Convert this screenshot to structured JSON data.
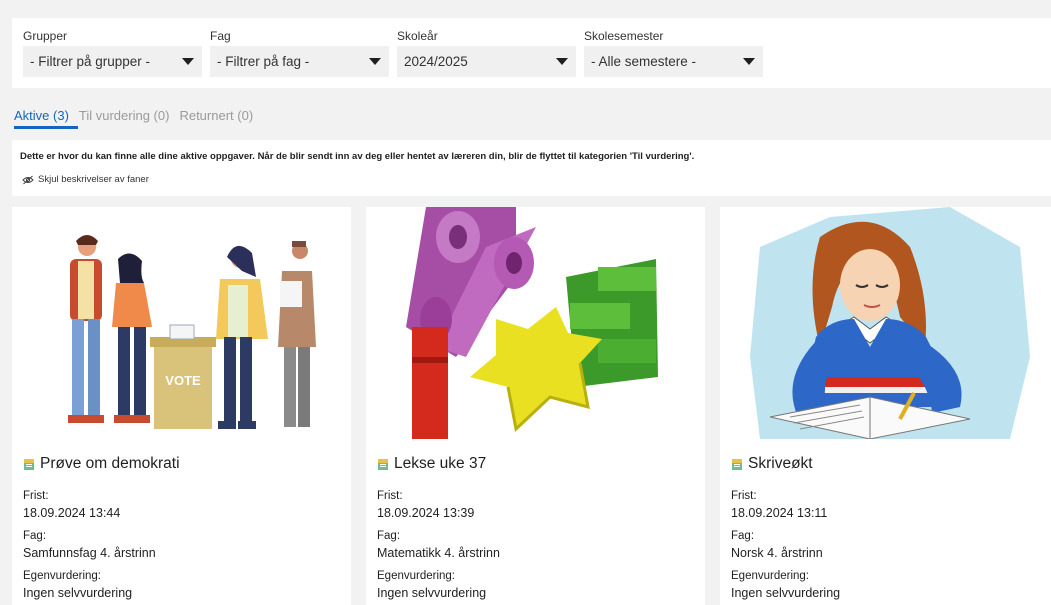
{
  "filters": [
    {
      "label": "Grupper",
      "value": "- Filtrer på grupper -"
    },
    {
      "label": "Fag",
      "value": "- Filtrer på fag -"
    },
    {
      "label": "Skoleår",
      "value": "2024/2025"
    },
    {
      "label": "Skolesemester",
      "value": "- Alle semestere -"
    }
  ],
  "tabs": [
    {
      "label": "Aktive (3)",
      "active": true
    },
    {
      "label": "Til vurdering (0)",
      "active": false
    },
    {
      "label": "Returnert (0)",
      "active": false
    }
  ],
  "description": "Dette er hvor du kan finne alle dine aktive oppgaver. Når de blir sendt inn av deg eller hentet av læreren din, blir de flyttet til kategorien 'Til vurdering'.",
  "hide_description_label": "Skjul beskrivelser av faner",
  "field_labels": {
    "deadline": "Frist:",
    "subject": "Fag:",
    "self_assessment": "Egenvurdering:"
  },
  "cards": [
    {
      "title": "Prøve om demokrati",
      "deadline": "18.09.2024 13:44",
      "subject": "Samfunnsfag 4. årstrinn",
      "self_assessment": "Ingen selvvurdering",
      "image_text": "VOTE"
    },
    {
      "title": "Lekse uke 37",
      "deadline": "18.09.2024 13:39",
      "subject": "Matematikk 4. årstrinn",
      "self_assessment": "Ingen selvvurdering"
    },
    {
      "title": "Skriveøkt",
      "deadline": "18.09.2024 13:11",
      "subject": "Norsk 4. årstrinn",
      "self_assessment": "Ingen selvvurdering"
    }
  ],
  "colors": {
    "accent": "#1565c0",
    "page_bg": "#f2f2f2",
    "select_bg": "#f0f0f0"
  }
}
